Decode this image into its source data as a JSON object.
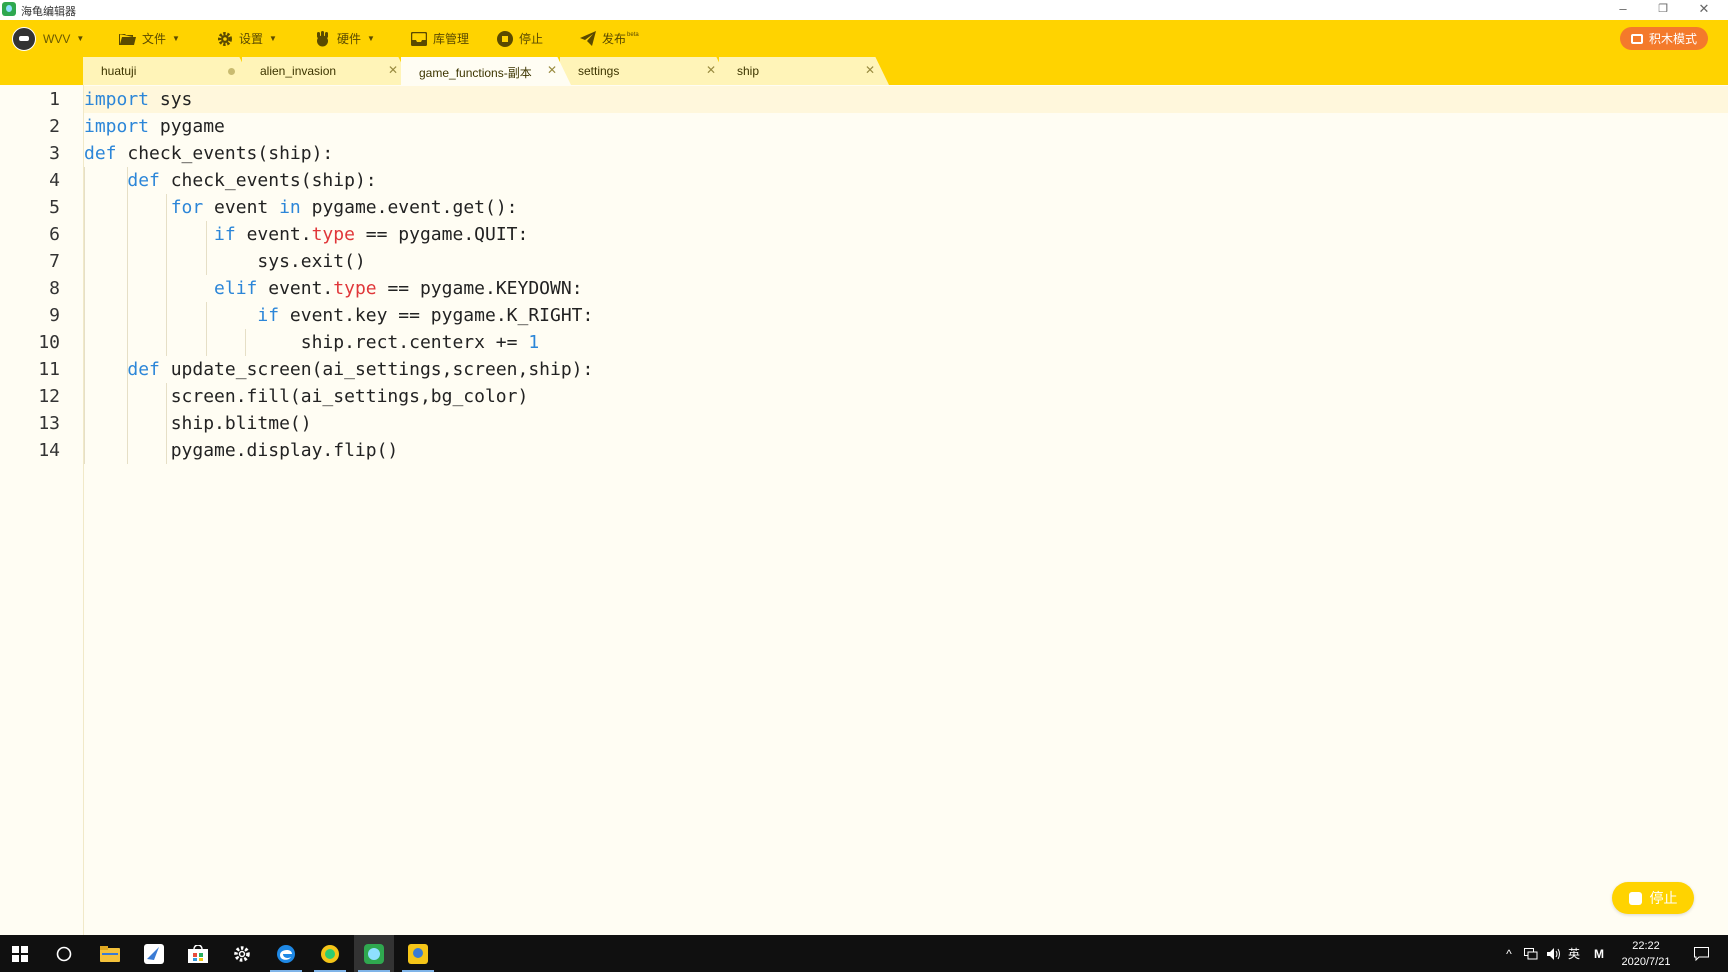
{
  "window": {
    "title": "海龟编辑器",
    "minimize": "–",
    "restore": "❐",
    "close": "✕"
  },
  "toolbar": {
    "user": "WVV",
    "file": "文件",
    "settings": "设置",
    "hardware": "硬件",
    "library": "库管理",
    "stop": "停止",
    "publish": "发布",
    "publish_badge": "beta",
    "blocks_mode": "积木模式",
    "accent": "#ffd300",
    "blocks_color": "#f47a2b"
  },
  "tabs": [
    {
      "label": "huatuji",
      "state": "modified"
    },
    {
      "label": "alien_invasion",
      "state": "close"
    },
    {
      "label": "game_functions-副本",
      "state": "close",
      "active": true
    },
    {
      "label": "settings",
      "state": "close"
    },
    {
      "label": "ship",
      "state": "close"
    }
  ],
  "editor": {
    "current_line": 1,
    "lines": [
      {
        "n": "1",
        "code": [
          {
            "t": "import",
            "c": "kw"
          },
          {
            "t": " sys"
          }
        ]
      },
      {
        "n": "2",
        "code": [
          {
            "t": "import",
            "c": "kw"
          },
          {
            "t": " pygame"
          }
        ]
      },
      {
        "n": "3",
        "code": [
          {
            "t": "def",
            "c": "kw"
          },
          {
            "t": " check_events(ship):"
          }
        ]
      },
      {
        "n": "4",
        "code": [
          {
            "t": "    "
          },
          {
            "t": "def",
            "c": "kw"
          },
          {
            "t": " check_events(ship):"
          }
        ]
      },
      {
        "n": "5",
        "code": [
          {
            "t": "        "
          },
          {
            "t": "for",
            "c": "kw"
          },
          {
            "t": " event "
          },
          {
            "t": "in",
            "c": "kw"
          },
          {
            "t": " pygame.event.get():"
          }
        ]
      },
      {
        "n": "6",
        "code": [
          {
            "t": "            "
          },
          {
            "t": "if",
            "c": "kw"
          },
          {
            "t": " event."
          },
          {
            "t": "type",
            "c": "prop"
          },
          {
            "t": " == pygame.QUIT:"
          }
        ]
      },
      {
        "n": "7",
        "code": [
          {
            "t": "                sys.exit()"
          }
        ]
      },
      {
        "n": "8",
        "code": [
          {
            "t": "            "
          },
          {
            "t": "elif",
            "c": "kw"
          },
          {
            "t": " event."
          },
          {
            "t": "type",
            "c": "prop"
          },
          {
            "t": " == pygame.KEYDOWN:"
          }
        ]
      },
      {
        "n": "9",
        "code": [
          {
            "t": "                "
          },
          {
            "t": "if",
            "c": "kw"
          },
          {
            "t": " event.key == pygame.K_RIGHT:"
          }
        ]
      },
      {
        "n": "10",
        "code": [
          {
            "t": "                    ship.rect.centerx += "
          },
          {
            "t": "1",
            "c": "num"
          }
        ]
      },
      {
        "n": "11",
        "code": [
          {
            "t": "    "
          },
          {
            "t": "def",
            "c": "kw"
          },
          {
            "t": " update_screen(ai_settings,screen,ship):"
          }
        ]
      },
      {
        "n": "12",
        "code": [
          {
            "t": "        screen.fill(ai_settings,bg_color)"
          }
        ]
      },
      {
        "n": "13",
        "code": [
          {
            "t": "        ship.blitme()"
          }
        ]
      },
      {
        "n": "14",
        "code": [
          {
            "t": "        pygame.display.flip()"
          }
        ]
      }
    ]
  },
  "float_stop": "停止",
  "taskbar": {
    "apps": [
      "windows-start-icon",
      "search-circle-icon",
      "file-explorer-icon",
      "email-app-icon",
      "store-icon",
      "settings-gear-icon",
      "edge-browser-icon",
      "green-app-icon",
      "turtle-editor-icon",
      "python-app-icon"
    ],
    "tray": {
      "chevron": "^",
      "ime": "英",
      "ime2": "M"
    },
    "time": "22:22",
    "date": "2020/7/21"
  }
}
